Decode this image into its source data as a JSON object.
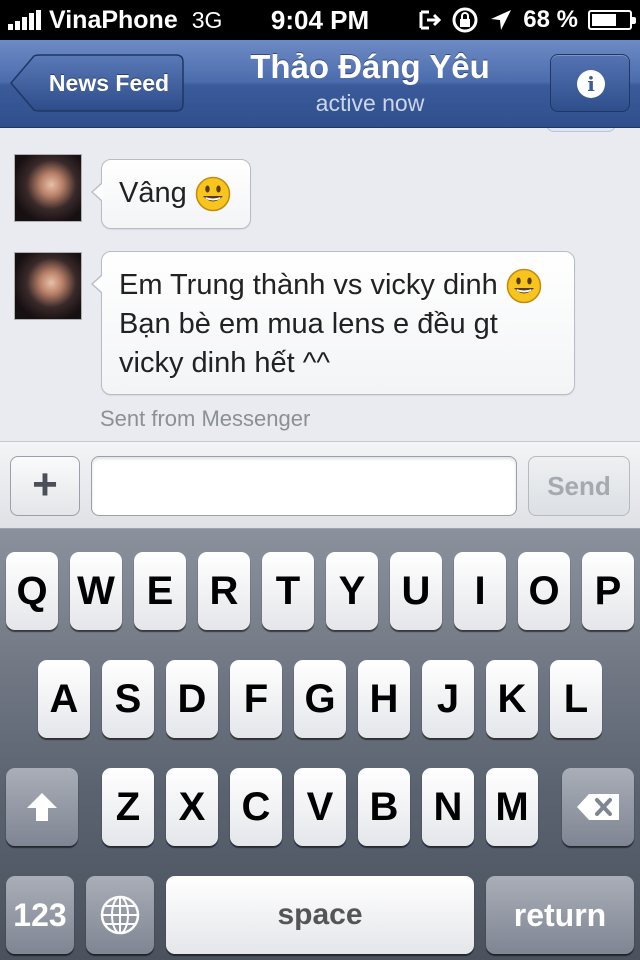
{
  "status_bar": {
    "carrier": "VinaPhone",
    "network": "3G",
    "time": "9:04 PM",
    "battery": "68 %",
    "battery_level": 0.68
  },
  "nav": {
    "back_label": "News Feed",
    "title": "Thảo Đáng Yêu",
    "subtitle": "active now",
    "info_icon": "info-icon"
  },
  "messages": [
    {
      "text_lines": [
        "Vâng"
      ],
      "emoji": "smiley"
    },
    {
      "text_lines": [
        "Em Trung thành vs vicky dinh",
        "Bạn bè em mua lens e đều gt",
        "vicky dinh hết ^^"
      ],
      "emoji": "smiley"
    }
  ],
  "sent_from": "Sent from Messenger",
  "composer": {
    "plus_label": "+",
    "placeholder": "",
    "send_label": "Send"
  },
  "keyboard": {
    "row1": [
      "Q",
      "W",
      "E",
      "R",
      "T",
      "Y",
      "U",
      "I",
      "O",
      "P"
    ],
    "row2": [
      "A",
      "S",
      "D",
      "F",
      "G",
      "H",
      "J",
      "K",
      "L"
    ],
    "row3": [
      "Z",
      "X",
      "C",
      "V",
      "B",
      "N",
      "M"
    ],
    "numbers_label": "123",
    "space_label": "space",
    "return_label": "return"
  },
  "colors": {
    "nav_blue": "#3b5a9a",
    "chat_bg": "#e9ebf0",
    "send_disabled": "#a5a9b0"
  }
}
